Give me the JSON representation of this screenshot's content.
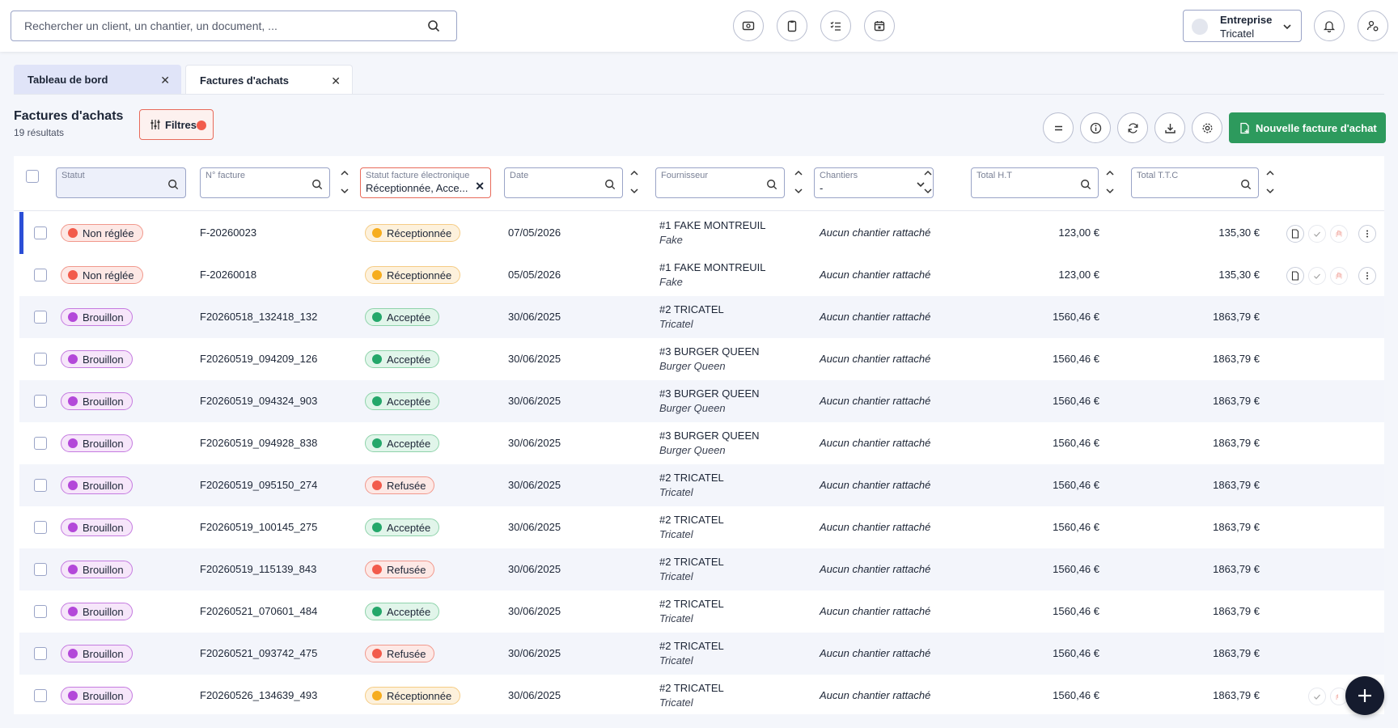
{
  "search": {
    "placeholder": "Rechercher un client, un chantier, un document, ..."
  },
  "header_icons": [
    "payment-icon",
    "clipboard-icon",
    "checklist-icon",
    "calendar-icon"
  ],
  "company": {
    "label": "Entreprise",
    "name": "Tricatel"
  },
  "tabs": [
    {
      "label": "Tableau de bord"
    },
    {
      "label": "Factures d'achats"
    }
  ],
  "page": {
    "title": "Factures d'achats",
    "count": "19 résultats",
    "filters_label": "Filtres",
    "new_button": "Nouvelle facture d'achat"
  },
  "columns": {
    "statut": {
      "label": "Statut",
      "value": ""
    },
    "numero": {
      "label": "N° facture",
      "value": ""
    },
    "statut_electronique": {
      "label": "Statut facture électronique",
      "value": "Réceptionnée, Acce..."
    },
    "date": {
      "label": "Date",
      "value": ""
    },
    "fournisseur": {
      "label": "Fournisseur",
      "value": ""
    },
    "chantiers": {
      "label": "Chantiers",
      "value": "-"
    },
    "total_ht": {
      "label": "Total H.T",
      "value": ""
    },
    "total_ttc": {
      "label": "Total T.T.C",
      "value": ""
    }
  },
  "colors": {
    "accent": "#2d9a5d",
    "selected_bar": "#2b4ed6",
    "fab": "#151b2e"
  },
  "rows": [
    {
      "statut": "Non réglée",
      "statut_color": "red",
      "numero": "F-20260023",
      "efact": "Réceptionnée",
      "efact_color": "yellow",
      "date": "07/05/2026",
      "supplier": "#1 FAKE MONTREUIL",
      "supplier_sub": "Fake",
      "chantier": "Aucun chantier rattaché",
      "ht": "123,00 €",
      "ttc": "135,30 €"
    },
    {
      "statut": "Non réglée",
      "statut_color": "red",
      "numero": "F-20260018",
      "efact": "Réceptionnée",
      "efact_color": "yellow",
      "date": "05/05/2026",
      "supplier": "#1 FAKE MONTREUIL",
      "supplier_sub": "Fake",
      "chantier": "Aucun chantier rattaché",
      "ht": "123,00 €",
      "ttc": "135,30 €"
    },
    {
      "statut": "Brouillon",
      "statut_color": "purple",
      "numero": "F20260518_132418_132",
      "efact": "Acceptée",
      "efact_color": "green",
      "date": "30/06/2025",
      "supplier": "#2 TRICATEL",
      "supplier_sub": "Tricatel",
      "chantier": "Aucun chantier rattaché",
      "ht": "1560,46 €",
      "ttc": "1863,79 €"
    },
    {
      "statut": "Brouillon",
      "statut_color": "purple",
      "numero": "F20260519_094209_126",
      "efact": "Acceptée",
      "efact_color": "green",
      "date": "30/06/2025",
      "supplier": "#3 BURGER QUEEN",
      "supplier_sub": "Burger Queen",
      "chantier": "Aucun chantier rattaché",
      "ht": "1560,46 €",
      "ttc": "1863,79 €"
    },
    {
      "statut": "Brouillon",
      "statut_color": "purple",
      "numero": "F20260519_094324_903",
      "efact": "Acceptée",
      "efact_color": "green",
      "date": "30/06/2025",
      "supplier": "#3 BURGER QUEEN",
      "supplier_sub": "Burger Queen",
      "chantier": "Aucun chantier rattaché",
      "ht": "1560,46 €",
      "ttc": "1863,79 €"
    },
    {
      "statut": "Brouillon",
      "statut_color": "purple",
      "numero": "F20260519_094928_838",
      "efact": "Acceptée",
      "efact_color": "green",
      "date": "30/06/2025",
      "supplier": "#3 BURGER QUEEN",
      "supplier_sub": "Burger Queen",
      "chantier": "Aucun chantier rattaché",
      "ht": "1560,46 €",
      "ttc": "1863,79 €"
    },
    {
      "statut": "Brouillon",
      "statut_color": "purple",
      "numero": "F20260519_095150_274",
      "efact": "Refusée",
      "efact_color": "red",
      "date": "30/06/2025",
      "supplier": "#2 TRICATEL",
      "supplier_sub": "Tricatel",
      "chantier": "Aucun chantier rattaché",
      "ht": "1560,46 €",
      "ttc": "1863,79 €"
    },
    {
      "statut": "Brouillon",
      "statut_color": "purple",
      "numero": "F20260519_100145_275",
      "efact": "Acceptée",
      "efact_color": "green",
      "date": "30/06/2025",
      "supplier": "#2 TRICATEL",
      "supplier_sub": "Tricatel",
      "chantier": "Aucun chantier rattaché",
      "ht": "1560,46 €",
      "ttc": "1863,79 €"
    },
    {
      "statut": "Brouillon",
      "statut_color": "purple",
      "numero": "F20260519_115139_843",
      "efact": "Refusée",
      "efact_color": "red",
      "date": "30/06/2025",
      "supplier": "#2 TRICATEL",
      "supplier_sub": "Tricatel",
      "chantier": "Aucun chantier rattaché",
      "ht": "1560,46 €",
      "ttc": "1863,79 €"
    },
    {
      "statut": "Brouillon",
      "statut_color": "purple",
      "numero": "F20260521_070601_484",
      "efact": "Acceptée",
      "efact_color": "green",
      "date": "30/06/2025",
      "supplier": "#2 TRICATEL",
      "supplier_sub": "Tricatel",
      "chantier": "Aucun chantier rattaché",
      "ht": "1560,46 €",
      "ttc": "1863,79 €"
    },
    {
      "statut": "Brouillon",
      "statut_color": "purple",
      "numero": "F20260521_093742_475",
      "efact": "Refusée",
      "efact_color": "red",
      "date": "30/06/2025",
      "supplier": "#2 TRICATEL",
      "supplier_sub": "Tricatel",
      "chantier": "Aucun chantier rattaché",
      "ht": "1560,46 €",
      "ttc": "1863,79 €"
    },
    {
      "statut": "Brouillon",
      "statut_color": "purple",
      "numero": "F20260526_134639_493",
      "efact": "Réceptionnée",
      "efact_color": "yellow",
      "date": "30/06/2025",
      "supplier": "#2 TRICATEL",
      "supplier_sub": "Tricatel",
      "chantier": "Aucun chantier rattaché",
      "ht": "1560,46 €",
      "ttc": "1863,79 €"
    }
  ]
}
